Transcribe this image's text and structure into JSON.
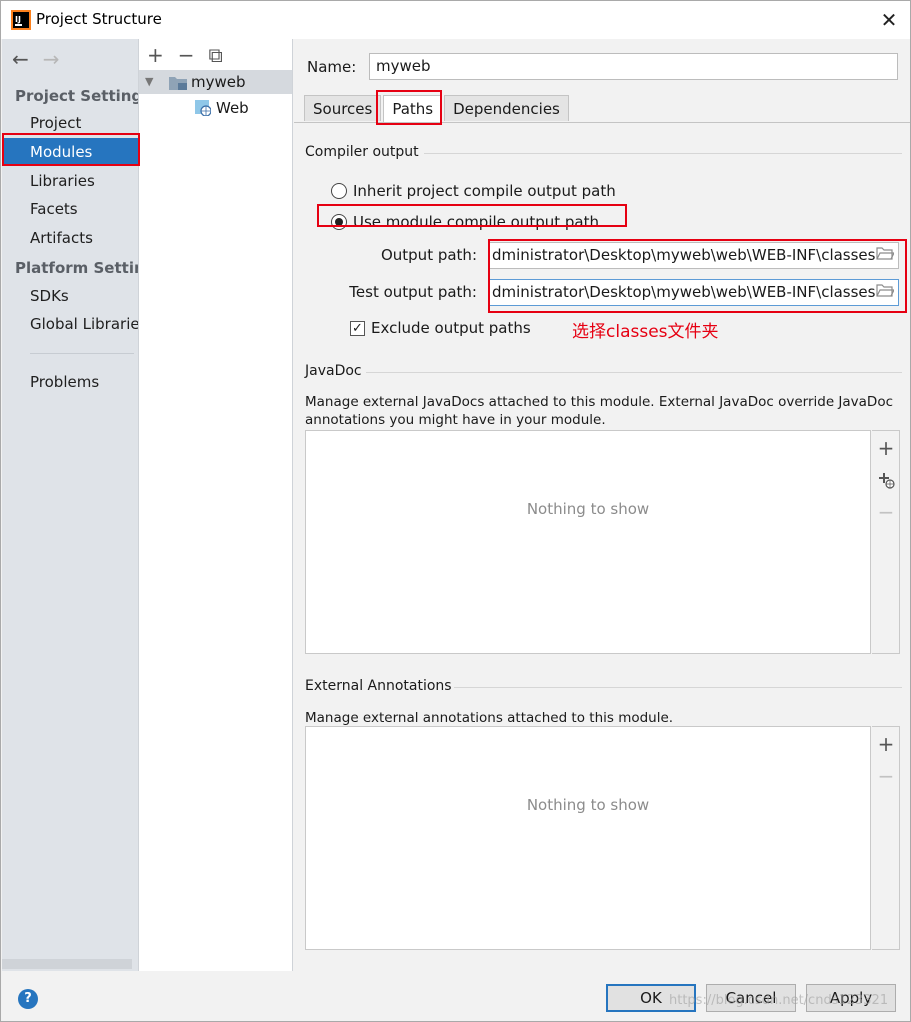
{
  "window": {
    "title": "Project Structure",
    "close_glyph": "✕"
  },
  "nav": {
    "back": "←",
    "forward": "→"
  },
  "sidebar": {
    "heading_project_settings": "Project Settings",
    "project_items": [
      "Project",
      "Modules",
      "Libraries",
      "Facets",
      "Artifacts"
    ],
    "heading_platform_settings": "Platform Setting",
    "platform_items": [
      "SDKs",
      "Global Libraries"
    ],
    "problems": "Problems",
    "selected": "Modules"
  },
  "tree": {
    "toolbar": {
      "add": "+",
      "remove": "−",
      "copy": "⧉"
    },
    "module": "myweb",
    "facet": "Web"
  },
  "module": {
    "name_label": "Name:",
    "name_value": "myweb",
    "tabs": [
      "Sources",
      "Paths",
      "Dependencies"
    ],
    "active_tab": "Paths"
  },
  "compiler_output": {
    "title": "Compiler output",
    "option_inherit": "Inherit project compile output path",
    "option_use_module": "Use module compile output path",
    "selected_option": "Use module compile output path",
    "output_path_label": "Output path:",
    "output_path_value": "dministrator\\Desktop\\myweb\\web\\WEB-INF\\classes",
    "test_output_path_label": "Test output path:",
    "test_output_path_value": "dministrator\\Desktop\\myweb\\web\\WEB-INF\\classes",
    "exclude_label": "Exclude output paths",
    "exclude_checked": true,
    "annotation": "选择classes文件夹"
  },
  "javadoc": {
    "title": "JavaDoc",
    "description": "Manage external JavaDocs attached to this module. External JavaDoc override JavaDoc annotations you might have in your module.",
    "empty": "Nothing to show"
  },
  "external_annotations": {
    "title": "External Annotations",
    "description": "Manage external annotations attached to this module.",
    "empty": "Nothing to show"
  },
  "buttons": {
    "help": "?",
    "ok": "OK",
    "cancel": "Cancel",
    "apply": "Apply"
  },
  "watermark": "https://blog.csdn.net/cnds123321",
  "colors": {
    "selection": "#2675bf",
    "highlight": "#e60012"
  }
}
